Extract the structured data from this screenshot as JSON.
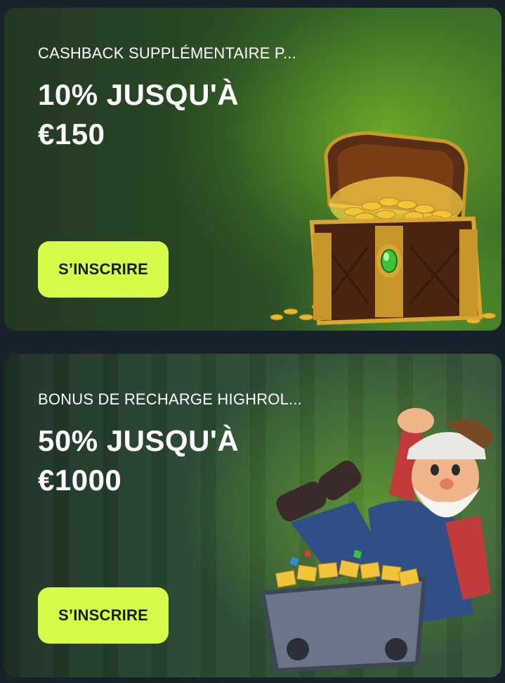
{
  "promos": [
    {
      "subtitle": "CASHBACK SUPPLÉMENTAIRE P...",
      "headline_line1": "10% JUSQU'À",
      "headline_line2": "€150",
      "cta_label": "S’INSCRIRE",
      "image_icon": "treasure-chest-illustration"
    },
    {
      "subtitle": "BONUS DE RECHARGE HIGHROL...",
      "headline_line1": "50% JUSQU'À",
      "headline_line2": "€1000",
      "cta_label": "S’INSCRIRE",
      "image_icon": "miner-with-gold-cart-illustration"
    }
  ],
  "colors": {
    "page_background": "#18222a",
    "cta_background": "#d7fd4a",
    "cta_text": "#142015",
    "text": "#ffffff"
  }
}
